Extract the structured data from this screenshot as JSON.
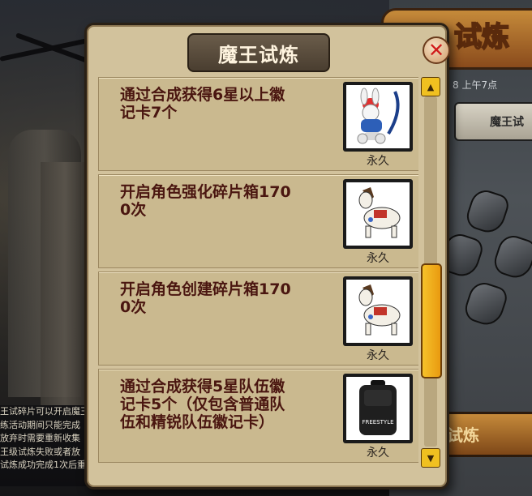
{
  "background": {
    "title": "试炼",
    "time_text": "8 上午7点",
    "tab_label": "魔王试",
    "action_button": "试炼",
    "side_text": [
      "王试碎片可以开启魔王",
      "练活动期间只能完成",
      "放弃时需要重新收集",
      "王级试炼失败或者放",
      "试炼成功完成1次后重"
    ]
  },
  "dialog": {
    "title": "魔王试炼",
    "tasks": [
      {
        "text": "通过合成获得6星以上徽\n记卡7个",
        "reward_icon": "rabbit-rider-icon",
        "reward_label": "永久"
      },
      {
        "text": "开启角色强化碎片箱170\n0次",
        "reward_icon": "horse-icon",
        "reward_label": "永久"
      },
      {
        "text": "开启角色创建碎片箱170\n0次",
        "reward_icon": "horse-icon",
        "reward_label": "永久"
      },
      {
        "text": "通过合成获得5星队伍徽\n记卡5个（仅包含普通队\n伍和精锐队伍徽记卡）",
        "reward_icon": "backpack-icon",
        "reward_label": "永久",
        "reward_item_text": "FREESTYLE"
      }
    ]
  },
  "scroll": {
    "position": 0.7,
    "visible_fraction": 0.32
  },
  "colors": {
    "panel": "#d2c29c",
    "row": "#cab98f",
    "task_text": "#4a1610",
    "scroll_thumb": "#f0b020",
    "close_x": "#d01b1b"
  }
}
